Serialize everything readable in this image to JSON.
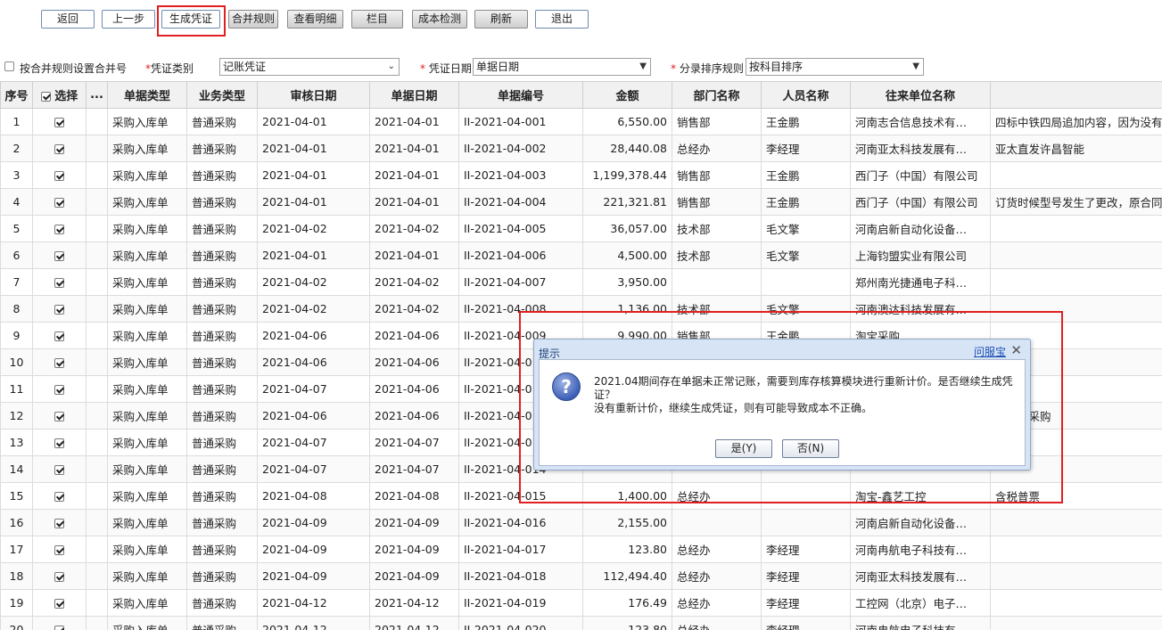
{
  "toolbar": {
    "buttons": [
      "返回",
      "上一步",
      "生成凭证",
      "合并规则",
      "查看明细",
      "栏目",
      "成本检测",
      "刷新",
      "退出"
    ]
  },
  "filters": {
    "merge_checkbox_label": "按合并规则设置合并号",
    "voucher_type_label": "凭证类别",
    "voucher_type_value": "记账凭证",
    "voucher_date_label": "凭证日期",
    "voucher_date_value": "单据日期",
    "sort_label": "分录排序规则",
    "sort_value": "按科目排序"
  },
  "grid": {
    "headers": [
      "序号",
      "选择",
      "...",
      "单据类型",
      "业务类型",
      "审核日期",
      "单据日期",
      "单据编号",
      "金额",
      "部门名称",
      "人员名称",
      "往来单位名称",
      ""
    ],
    "rows": [
      [
        "1",
        "",
        "",
        "采购入库单",
        "普通采购",
        "2021-04-01",
        "2021-04-01",
        "II-2021-04-001",
        "6,550.00",
        "销售部",
        "王金鹏",
        "河南志合信息技术有…",
        "四标中铁四局追加内容，因为没有"
      ],
      [
        "2",
        "",
        "",
        "采购入库单",
        "普通采购",
        "2021-04-01",
        "2021-04-01",
        "II-2021-04-002",
        "28,440.08",
        "总经办",
        "李经理",
        "河南亚太科技发展有…",
        "亚太直发许昌智能"
      ],
      [
        "3",
        "",
        "",
        "采购入库单",
        "普通采购",
        "2021-04-01",
        "2021-04-01",
        "II-2021-04-003",
        "1,199,378.44",
        "销售部",
        "王金鹏",
        "西门子（中国）有限公司",
        ""
      ],
      [
        "4",
        "",
        "",
        "采购入库单",
        "普通采购",
        "2021-04-01",
        "2021-04-01",
        "II-2021-04-004",
        "221,321.81",
        "销售部",
        "王金鹏",
        "西门子（中国）有限公司",
        "订货时候型号发生了更改，原合同"
      ],
      [
        "5",
        "",
        "",
        "采购入库单",
        "普通采购",
        "2021-04-02",
        "2021-04-02",
        "II-2021-04-005",
        "36,057.00",
        "技术部",
        "毛文擎",
        "河南启新自动化设备…",
        ""
      ],
      [
        "6",
        "",
        "",
        "采购入库单",
        "普通采购",
        "2021-04-01",
        "2021-04-01",
        "II-2021-04-006",
        "4,500.00",
        "技术部",
        "毛文擎",
        "上海钧盟实业有限公司",
        ""
      ],
      [
        "7",
        "",
        "",
        "采购入库单",
        "普通采购",
        "2021-04-02",
        "2021-04-02",
        "II-2021-04-007",
        "3,950.00",
        "",
        "",
        "郑州南光捷通电子科…",
        ""
      ],
      [
        "8",
        "",
        "",
        "采购入库单",
        "普通采购",
        "2021-04-02",
        "2021-04-02",
        "II-2021-04-008",
        "1,136.00",
        "技术部",
        "毛文擎",
        "河南澳达科技发展有…",
        ""
      ],
      [
        "9",
        "",
        "",
        "采购入库单",
        "普通采购",
        "2021-04-06",
        "2021-04-06",
        "II-2021-04-009",
        "9,990.00",
        "销售部",
        "王金鹏",
        "淘宝采购",
        ""
      ],
      [
        "10",
        "",
        "",
        "采购入库单",
        "普通采购",
        "2021-04-06",
        "2021-04-06",
        "II-2021-04-010",
        "",
        "",
        "",
        "",
        ""
      ],
      [
        "11",
        "",
        "",
        "采购入库单",
        "普通采购",
        "2021-04-07",
        "2021-04-06",
        "II-2021-04-011",
        "",
        "",
        "",
        "",
        ""
      ],
      [
        "12",
        "",
        "",
        "采购入库单",
        "普通采购",
        "2021-04-06",
        "2021-04-06",
        "II-2021-04-012",
        "",
        "",
        "",
        "",
        "入转为采购"
      ],
      [
        "13",
        "",
        "",
        "采购入库单",
        "普通采购",
        "2021-04-07",
        "2021-04-07",
        "II-2021-04-013",
        "",
        "",
        "",
        "",
        ""
      ],
      [
        "14",
        "",
        "",
        "采购入库单",
        "普通采购",
        "2021-04-07",
        "2021-04-07",
        "II-2021-04-014",
        "",
        "",
        "",
        "",
        ""
      ],
      [
        "15",
        "",
        "",
        "采购入库单",
        "普通采购",
        "2021-04-08",
        "2021-04-08",
        "II-2021-04-015",
        "1,400.00",
        "总经办",
        "",
        "淘宝-鑫艺工控",
        "含税普票"
      ],
      [
        "16",
        "",
        "",
        "采购入库单",
        "普通采购",
        "2021-04-09",
        "2021-04-09",
        "II-2021-04-016",
        "2,155.00",
        "",
        "",
        "河南启新自动化设备…",
        ""
      ],
      [
        "17",
        "",
        "",
        "采购入库单",
        "普通采购",
        "2021-04-09",
        "2021-04-09",
        "II-2021-04-017",
        "123.80",
        "总经办",
        "李经理",
        "河南冉航电子科技有…",
        ""
      ],
      [
        "18",
        "",
        "",
        "采购入库单",
        "普通采购",
        "2021-04-09",
        "2021-04-09",
        "II-2021-04-018",
        "112,494.40",
        "总经办",
        "李经理",
        "河南亚太科技发展有…",
        ""
      ],
      [
        "19",
        "",
        "",
        "采购入库单",
        "普通采购",
        "2021-04-12",
        "2021-04-12",
        "II-2021-04-019",
        "176.49",
        "总经办",
        "李经理",
        "工控网（北京）电子…",
        ""
      ],
      [
        "20",
        "",
        "",
        "采购入库单",
        "普通采购",
        "2021-04-12",
        "2021-04-12",
        "II-2021-04-020",
        "123.80",
        "总经办",
        "李经理",
        "河南冉航电子科技有…",
        ""
      ]
    ]
  },
  "dialog": {
    "title": "提示",
    "help_link": "问服宝",
    "close_glyph": "✕",
    "message_line1": "2021.04期间存在单据未正常记账，需要到库存核算模块进行重新计价。是否继续生成凭证？",
    "message_line2": "没有重新计价，继续生成凭证，则有可能导致成本不正确。",
    "yes_label": "是(Y)",
    "no_label": "否(N)",
    "icon": "question-icon"
  },
  "colors": {
    "highlight": "#e02020",
    "dialog_bg": "#d7e4f5",
    "link": "#1c4fb5"
  }
}
